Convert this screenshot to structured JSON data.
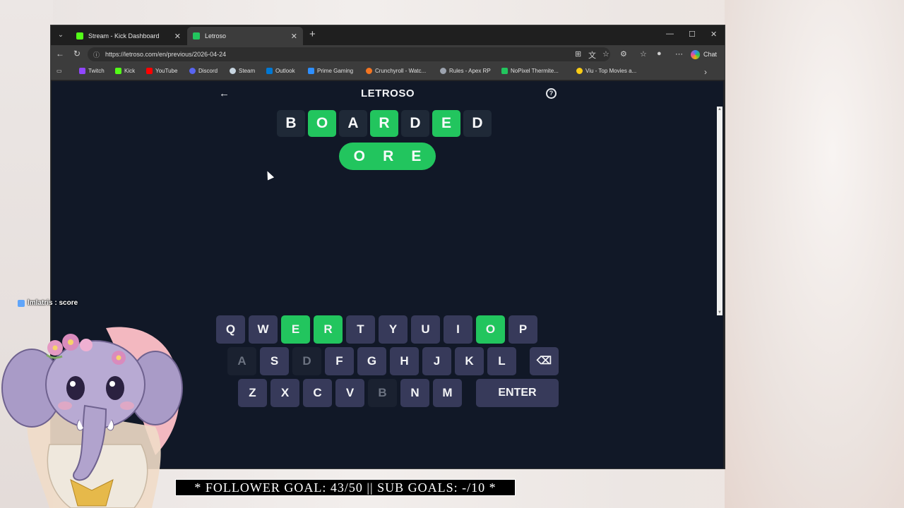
{
  "browser": {
    "tabs": [
      {
        "title": "Stream - Kick Dashboard",
        "favicon_color": "#53fc18"
      },
      {
        "title": "Letroso",
        "favicon_color": "#22c55e"
      }
    ],
    "url": "https://letroso.com/en/previous/2026-04-24",
    "chat_label": "Chat",
    "bookmarks": [
      {
        "label": "Twitch",
        "color": "#9146ff"
      },
      {
        "label": "Kick",
        "color": "#53fc18"
      },
      {
        "label": "YouTube",
        "color": "#ff0000"
      },
      {
        "label": "Discord",
        "color": "#5865f2"
      },
      {
        "label": "Steam",
        "color": "#c7d5e0"
      },
      {
        "label": "Outlook",
        "color": "#0078d4"
      },
      {
        "label": "Prime Gaming",
        "color": "#2e8fff"
      },
      {
        "label": "Crunchyroll - Watc...",
        "color": "#f47521"
      },
      {
        "label": "Rules - Apex RP",
        "color": "#9ca3af"
      },
      {
        "label": "NoPixel Thermite...",
        "color": "#22c55e"
      },
      {
        "label": "Viu - Top Movies a...",
        "color": "#facc15"
      }
    ]
  },
  "game": {
    "title": "LETROSO",
    "help": "?",
    "guess": [
      {
        "letter": "B",
        "state": "gray"
      },
      {
        "letter": "O",
        "state": "green"
      },
      {
        "letter": "A",
        "state": "gray"
      },
      {
        "letter": "R",
        "state": "green"
      },
      {
        "letter": "D",
        "state": "gray"
      },
      {
        "letter": "E",
        "state": "green"
      },
      {
        "letter": "D",
        "state": "gray"
      }
    ],
    "answer_letters": [
      "O",
      "R",
      "E"
    ],
    "keyboard": {
      "row1": [
        {
          "k": "Q",
          "s": "n"
        },
        {
          "k": "W",
          "s": "n"
        },
        {
          "k": "E",
          "s": "g"
        },
        {
          "k": "R",
          "s": "g"
        },
        {
          "k": "T",
          "s": "n"
        },
        {
          "k": "Y",
          "s": "n"
        },
        {
          "k": "U",
          "s": "n"
        },
        {
          "k": "I",
          "s": "n"
        },
        {
          "k": "O",
          "s": "g"
        },
        {
          "k": "P",
          "s": "n"
        }
      ],
      "row2": [
        {
          "k": "A",
          "s": "a"
        },
        {
          "k": "S",
          "s": "n"
        },
        {
          "k": "D",
          "s": "a"
        },
        {
          "k": "F",
          "s": "n"
        },
        {
          "k": "G",
          "s": "n"
        },
        {
          "k": "H",
          "s": "n"
        },
        {
          "k": "J",
          "s": "n"
        },
        {
          "k": "K",
          "s": "n"
        },
        {
          "k": "L",
          "s": "n"
        }
      ],
      "row3": [
        {
          "k": "Z",
          "s": "n"
        },
        {
          "k": "X",
          "s": "n"
        },
        {
          "k": "C",
          "s": "n"
        },
        {
          "k": "V",
          "s": "n"
        },
        {
          "k": "B",
          "s": "a"
        },
        {
          "k": "N",
          "s": "n"
        },
        {
          "k": "M",
          "s": "n"
        }
      ],
      "backspace": "⌫",
      "enter": "ENTER"
    }
  },
  "overlay": {
    "chat_message": "lmlatris : score",
    "goal_banner": "* FOLLOWER GOAL: 43/50 || SUB GOALS: -/10 *"
  }
}
